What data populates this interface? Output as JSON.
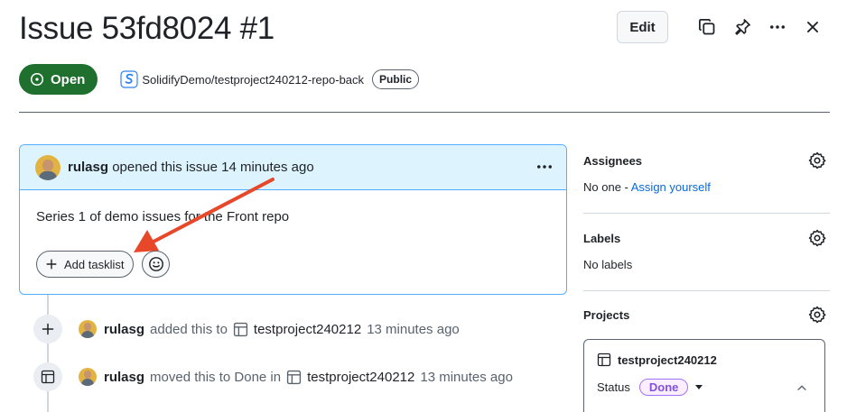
{
  "issue": {
    "title": "Issue 53fd8024 #1",
    "state": "Open",
    "repo": "SolidifyDemo/testproject240212-repo-back",
    "visibility": "Public"
  },
  "header_actions": {
    "edit_label": "Edit",
    "icons": [
      "copy-icon",
      "pin-icon",
      "kebab-horizontal-icon",
      "close-icon"
    ]
  },
  "comment": {
    "author": "rulasg",
    "action": "opened this issue 14 minutes ago",
    "body": "Series 1 of demo issues for the Front repo",
    "add_tasklist_label": "Add tasklist"
  },
  "timeline": [
    {
      "icon": "plus-icon",
      "actor": "rulasg",
      "action": "added this to",
      "project": "testproject240212",
      "when": "13 minutes ago"
    },
    {
      "icon": "table-icon",
      "actor": "rulasg",
      "action": "moved this to Done in",
      "project": "testproject240212",
      "when": "13 minutes ago"
    }
  ],
  "sidebar": {
    "assignees": {
      "title": "Assignees",
      "value_prefix": "No one - ",
      "value_link": "Assign yourself"
    },
    "labels": {
      "title": "Labels",
      "value": "No labels"
    },
    "projects": {
      "title": "Projects",
      "project_name": "testproject240212",
      "status_label": "Status",
      "status_value": "Done"
    }
  },
  "colors": {
    "open_badge": "#1f6f2e",
    "accent_blue": "#0969da",
    "done_purple": "#8250df",
    "annotation_arrow": "#e8482a"
  }
}
